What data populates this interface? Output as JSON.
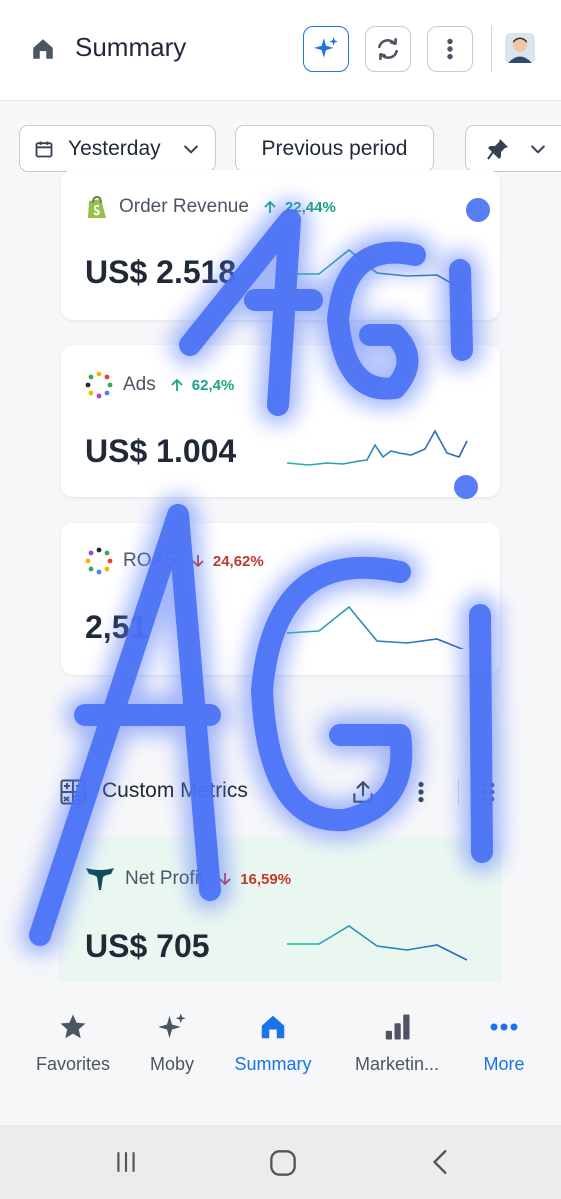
{
  "header": {
    "title": "Summary"
  },
  "filters": {
    "date_range": "Yesterday",
    "comparison": "Previous period"
  },
  "metrics": [
    {
      "name": "Order Revenue",
      "change": "22,44%",
      "direction": "up",
      "value": "US$ 2.518",
      "icon": "shopify-icon"
    },
    {
      "name": "Ads",
      "change": "62,4%",
      "direction": "up",
      "value": "US$ 1.004",
      "icon": "dots-ring-icon"
    },
    {
      "name": "ROAS",
      "change": "24,62%",
      "direction": "down",
      "value": "2,51",
      "icon": "dots-ring-icon"
    }
  ],
  "custom_metrics": {
    "title": "Custom Metrics",
    "card": {
      "name": "Net Profit",
      "change": "16,59%",
      "direction": "down",
      "value": "US$ 705",
      "icon": "triple-whale-icon"
    }
  },
  "bottom_nav": {
    "items": [
      {
        "label": "Favorites",
        "icon": "star-icon"
      },
      {
        "label": "Moby",
        "icon": "sparkle-icon"
      },
      {
        "label": "Summary",
        "icon": "home-icon",
        "active": true
      },
      {
        "label": "Marketin...",
        "icon": "bar-chart-icon"
      },
      {
        "label": "More",
        "icon": "dots-horizontal-icon",
        "active": true
      }
    ]
  },
  "colors": {
    "accent": "#1a73e8",
    "positive": "#1aa385",
    "negative": "#c0392b",
    "custom_card_bg": "#eaf7f1",
    "scribble": "#4a72f5"
  },
  "handwriting_overlay": "AGI AGI"
}
